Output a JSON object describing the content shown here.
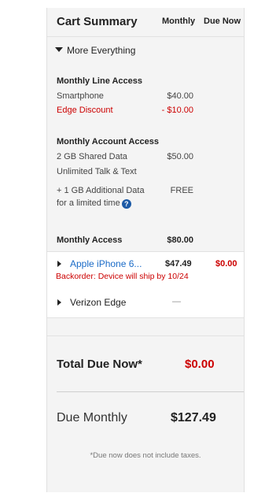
{
  "header": {
    "title": "Cart Summary",
    "col_monthly": "Monthly",
    "col_due_now": "Due Now"
  },
  "plan": {
    "toggle_label": "More Everything",
    "line_access": {
      "heading": "Monthly Line Access",
      "items": [
        {
          "label": "Smartphone",
          "monthly": "$40.00",
          "style": "normal"
        },
        {
          "label": "Edge Discount",
          "monthly": "- $10.00",
          "style": "discount"
        }
      ]
    },
    "account_access": {
      "heading": "Monthly Account Access",
      "items": [
        {
          "label": "2 GB Shared Data",
          "monthly": "$50.00"
        },
        {
          "label": "Unlimited Talk & Text",
          "monthly": ""
        }
      ],
      "promo_line1": "+ 1 GB Additional Data",
      "promo_line2": "for a limited time",
      "promo_value": "FREE",
      "help_icon": "help-icon",
      "help_glyph": "?"
    },
    "monthly_access": {
      "label": "Monthly Access",
      "monthly": "$80.00"
    }
  },
  "device": {
    "name": "Apple iPhone 6...",
    "monthly": "$47.49",
    "due_now": "$0.00",
    "backorder_note": "Backorder: Device will ship by 10/24"
  },
  "edge": {
    "label": "Verizon Edge",
    "value": "—"
  },
  "totals": {
    "due_now_label": "Total Due Now*",
    "due_now_value": "$0.00",
    "monthly_label": "Due Monthly",
    "monthly_value": "$127.49",
    "footnote": "*Due now does not include taxes."
  },
  "colors": {
    "accent_red": "#cc0000",
    "link_blue": "#1a6bc7",
    "panel_bg": "#f4f4f4"
  }
}
